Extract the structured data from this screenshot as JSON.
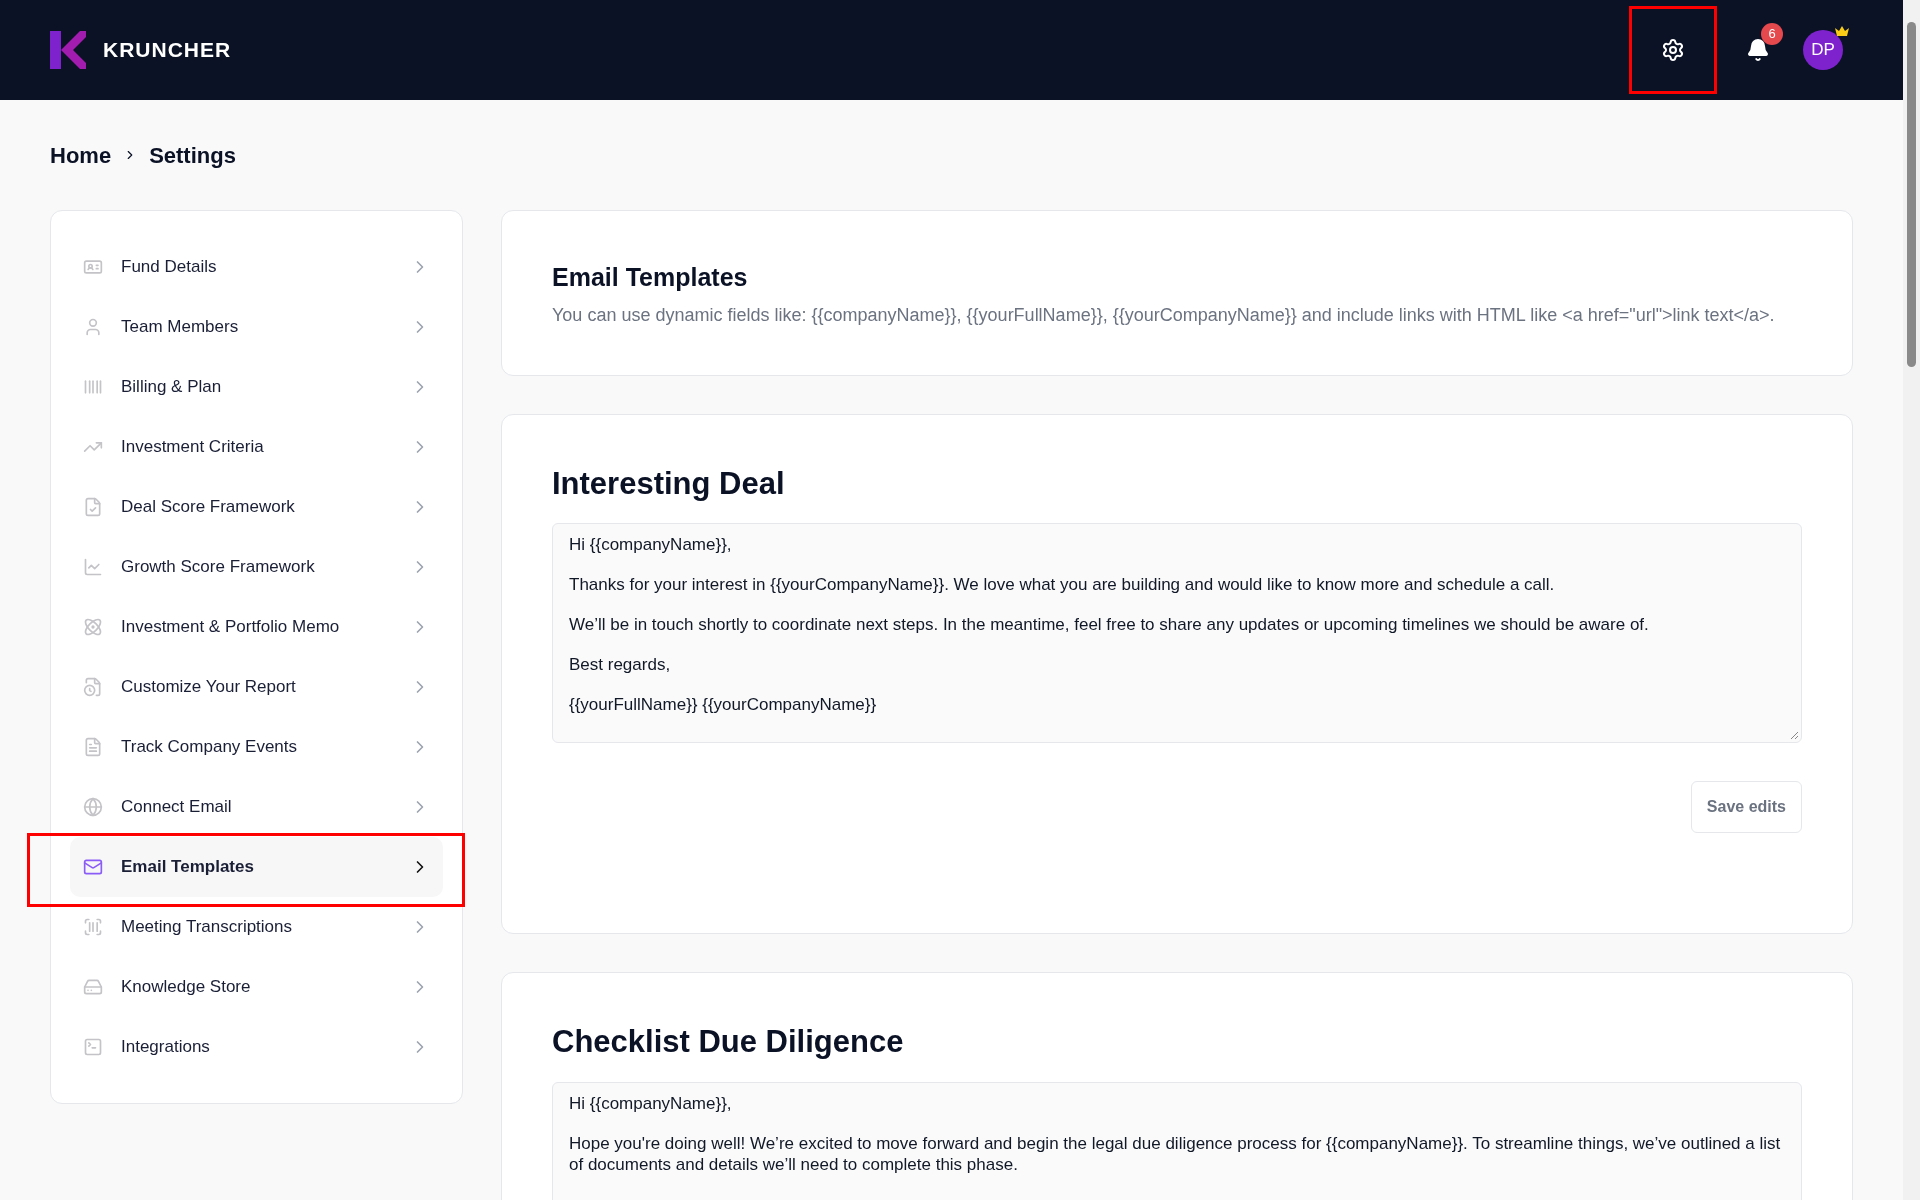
{
  "header": {
    "brand": "KRUNCHER",
    "settings_highlighted": true,
    "notification_count": "6",
    "avatar_initials": "DP"
  },
  "breadcrumb": [
    "Home",
    "Settings"
  ],
  "sidebar": {
    "items": [
      {
        "label": "Fund Details",
        "selected": false,
        "highlighted": false
      },
      {
        "label": "Team Members",
        "selected": false,
        "highlighted": false
      },
      {
        "label": "Billing & Plan",
        "selected": false,
        "highlighted": false
      },
      {
        "label": "Investment Criteria",
        "selected": false,
        "highlighted": false
      },
      {
        "label": "Deal Score Framework",
        "selected": false,
        "highlighted": false
      },
      {
        "label": "Growth Score Framework",
        "selected": false,
        "highlighted": false
      },
      {
        "label": "Investment & Portfolio Memo",
        "selected": false,
        "highlighted": false
      },
      {
        "label": "Customize Your Report",
        "selected": false,
        "highlighted": false
      },
      {
        "label": "Track Company Events",
        "selected": false,
        "highlighted": false
      },
      {
        "label": "Connect Email",
        "selected": false,
        "highlighted": false
      },
      {
        "label": "Email Templates",
        "selected": true,
        "highlighted": true
      },
      {
        "label": "Meeting Transcriptions",
        "selected": false,
        "highlighted": false
      },
      {
        "label": "Knowledge Store",
        "selected": false,
        "highlighted": false
      },
      {
        "label": "Integrations",
        "selected": false,
        "highlighted": false
      }
    ]
  },
  "intro": {
    "title": "Email Templates",
    "description": "You can use dynamic fields like: {{companyName}}, {{yourFullName}}, {{yourCompanyName}} and include links with HTML like <a href=\"url\">link text</a>."
  },
  "templates": [
    {
      "title": "Interesting Deal",
      "lines": [
        "Hi {{companyName}},",
        "Thanks for your interest in {{yourCompanyName}}. We love what you are building and would like to know more and schedule a call.",
        "We’ll be in touch shortly to coordinate next steps. In the meantime, feel free to share any updates or upcoming timelines we should be aware of.",
        "Best regards,",
        "{{yourFullName}} {{yourCompanyName}}"
      ],
      "resize_grip": true,
      "save_label": "Save edits"
    },
    {
      "title": "Checklist Due Diligence",
      "lines": [
        "Hi {{companyName}},",
        "Hope you're doing well! We’re excited to move forward and begin the legal due diligence process for {{companyName}}. To streamline things, we’ve outlined a list of documents and details we’ll need to complete this phase."
      ]
    }
  ]
}
